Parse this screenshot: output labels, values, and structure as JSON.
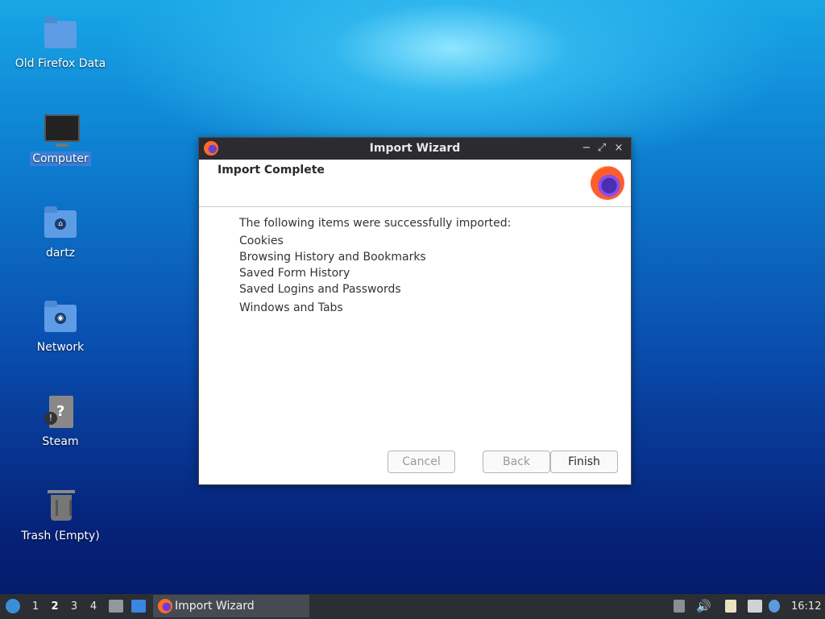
{
  "desktop": {
    "icons": [
      {
        "label": "Old Firefox Data"
      },
      {
        "label": "Computer"
      },
      {
        "label": "dartz"
      },
      {
        "label": "Network"
      },
      {
        "label": "Steam"
      },
      {
        "label": "Trash (Empty)"
      }
    ]
  },
  "dialog": {
    "title": "Import Wizard",
    "header": "Import Complete",
    "intro": "The following items were successfully imported:",
    "items": [
      "Cookies",
      "Browsing History and Bookmarks",
      "Saved Form History",
      "Saved Logins and Passwords",
      "Windows and Tabs"
    ],
    "buttons": {
      "cancel": "Cancel",
      "back": "Back",
      "finish": "Finish"
    },
    "window_controls": {
      "minimize": "−",
      "maximize": "⤢",
      "close": "×"
    }
  },
  "taskbar": {
    "workspaces": [
      "1",
      "2",
      "3",
      "4"
    ],
    "active_workspace": "2",
    "task_label": "Import Wizard",
    "clock": "16:12"
  }
}
